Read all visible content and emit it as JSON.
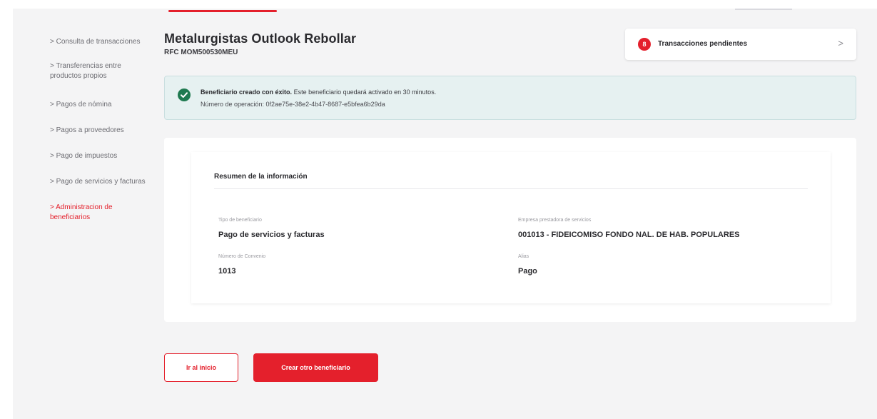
{
  "sidebar": {
    "items": [
      {
        "label": "> Consulta de transacciones"
      },
      {
        "label": "> Transferencias entre productos propios"
      },
      {
        "label": "> Pagos de nómina"
      },
      {
        "label": "> Pagos a proveedores"
      },
      {
        "label": "> Pago de impuestos"
      },
      {
        "label": "> Pago de servicios y facturas"
      },
      {
        "label": "> Administracion de beneficiarios",
        "active": true
      }
    ]
  },
  "header": {
    "company_name": "Metalurgistas Outlook Rebollar",
    "rfc": "RFC MOM500530MEU"
  },
  "pending": {
    "count": "8",
    "label": "Transacciones pendientes",
    "chevron": ">"
  },
  "alert": {
    "title": "Beneficiario creado con éxito.",
    "message": "Este beneficiario quedará activado en 30 minutos.",
    "operation": "Número de operación: 0f2ae75e-38e2-4b47-8687-e5bfea6b29da",
    "icon": "check-circle-icon"
  },
  "summary": {
    "title": "Resumen de la información",
    "fields": [
      {
        "label": "Tipo de beneficiario",
        "value": "Pago de servicios y facturas"
      },
      {
        "label": "Empresa prestadora de servicios",
        "value": "001013 - FIDEICOMISO FONDO NAL. DE HAB. POPULARES"
      },
      {
        "label": "Número de Convenio",
        "value": "1013"
      },
      {
        "label": "Alias",
        "value": "Pago"
      }
    ]
  },
  "buttons": {
    "home_label": "Ir al inicio",
    "create_label": "Crear otro beneficiario"
  },
  "colors": {
    "accent": "#e4202c",
    "success": "#1f7a50",
    "alert_bg": "#e6f1f1"
  }
}
